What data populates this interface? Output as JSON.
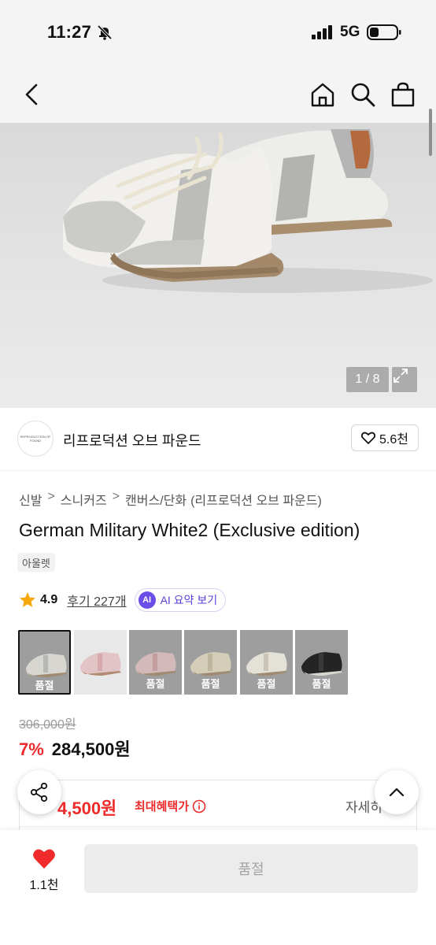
{
  "status": {
    "time": "11:27",
    "network": "5G"
  },
  "gallery": {
    "counter": "1 / 8"
  },
  "brand": {
    "name": "리프로덕션 오브 파운드",
    "logo_text": "REPRODUCTION OF FOUND",
    "likes": "5.6천"
  },
  "breadcrumb": [
    "신발",
    "스니커즈",
    "캔버스/단화",
    "(리프로덕션 오브 파운드)"
  ],
  "product": {
    "title": "German Military White2 (Exclusive edition)",
    "tag": "아울렛",
    "rating": "4.9",
    "reviews": "후기 227개",
    "ai_badge": "AI",
    "ai_summary": "AI 요약 보기"
  },
  "swatches": [
    {
      "label": "품절",
      "color": "grey",
      "selected": true
    },
    {
      "label": "",
      "color": "pink",
      "selected": false
    },
    {
      "label": "품절",
      "color": "pink",
      "selected": false
    },
    {
      "label": "품절",
      "color": "beige",
      "selected": false
    },
    {
      "label": "품절",
      "color": "cream",
      "selected": false
    },
    {
      "label": "품절",
      "color": "black",
      "selected": false
    }
  ],
  "price": {
    "original": "306,000원",
    "discount": "7%",
    "final": "284,500원"
  },
  "benefit": {
    "amount": "4,500원",
    "label": "최대혜택가",
    "detail": "자세히"
  },
  "bottom": {
    "wish_count": "1.1천",
    "buy_label": "품절"
  },
  "colors": {
    "accent_red": "#ee2a2a",
    "ai_purple": "#6b4ee8",
    "disabled_grey": "#ececec"
  }
}
